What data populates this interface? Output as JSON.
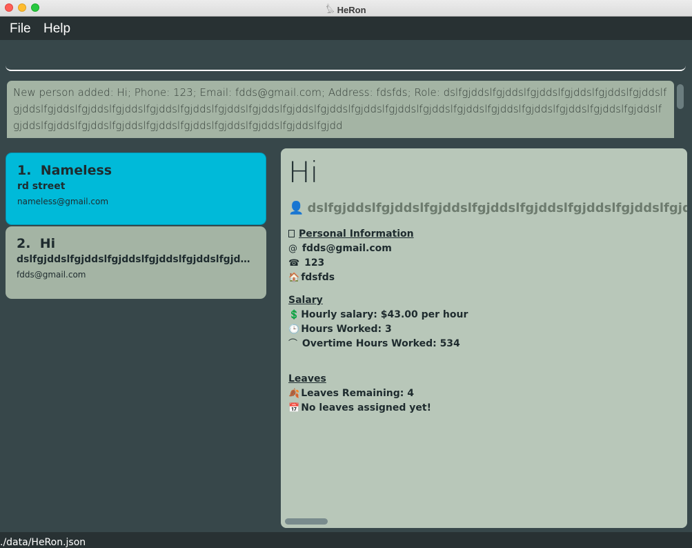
{
  "window": {
    "title": "HeRon",
    "icon": "heron-app-icon"
  },
  "menu": {
    "file": "File",
    "help": "Help"
  },
  "command_box": {
    "value": "",
    "placeholder": ""
  },
  "result": {
    "text": "New person added: Hi; Phone: 123; Email: fdds@gmail.com; Address: fdsfds; Role: dslfgjddslfgjddslfgjddslfgjddslfgjddslfgjddslfgjddslfgjddslfgjddslfgjddslfgjddslfgjddslfgjddslfgjddslfgjddslfgjddslfgjddslfgjddslfgjddslfgjddslfgjddslfgjddslfgjddslfgjddslfgjddslfgjddslfgjddslfgjddslfgjddslfgjddslfgjddslfgjddslfgjddslfgjddslfgjdd"
  },
  "persons": [
    {
      "index": "1.",
      "name": "Nameless",
      "role": "rd street",
      "email": "nameless@gmail.com"
    },
    {
      "index": "2.",
      "name": "Hi",
      "role": "dslfgjddslfgjddslfgjddslfgjddslfgjddslfgjddslfgjddslf...",
      "email": "fdds@gmail.com"
    }
  ],
  "detail": {
    "name": "Hi",
    "role": "dslfgjddslfgjddslfgjddslfgjddslfgjddslfgjddslfgjddslfgjd",
    "personal_info_title": "Personal Information",
    "email_icon": "@",
    "email": "fdds@gmail.com",
    "phone_icon": "☎",
    "phone": "123",
    "address_icon": "🏠",
    "address": "fdsfds",
    "salary_title": "Salary",
    "salary_icon": "💲",
    "hourly_salary": "Hourly salary: $43.00 per hour",
    "hours_icon": "🕒",
    "hours_worked": "Hours Worked: 3",
    "overtime_icon": "⌒",
    "overtime": "Overtime Hours Worked: 534",
    "leaves_title": "Leaves",
    "leaves_icon": "🍂",
    "leaves_remaining": "Leaves Remaining: 4",
    "calendar_icon": "📅",
    "no_leaves": "No leaves assigned yet!"
  },
  "status": {
    "path": "./data/HeRon.json"
  }
}
